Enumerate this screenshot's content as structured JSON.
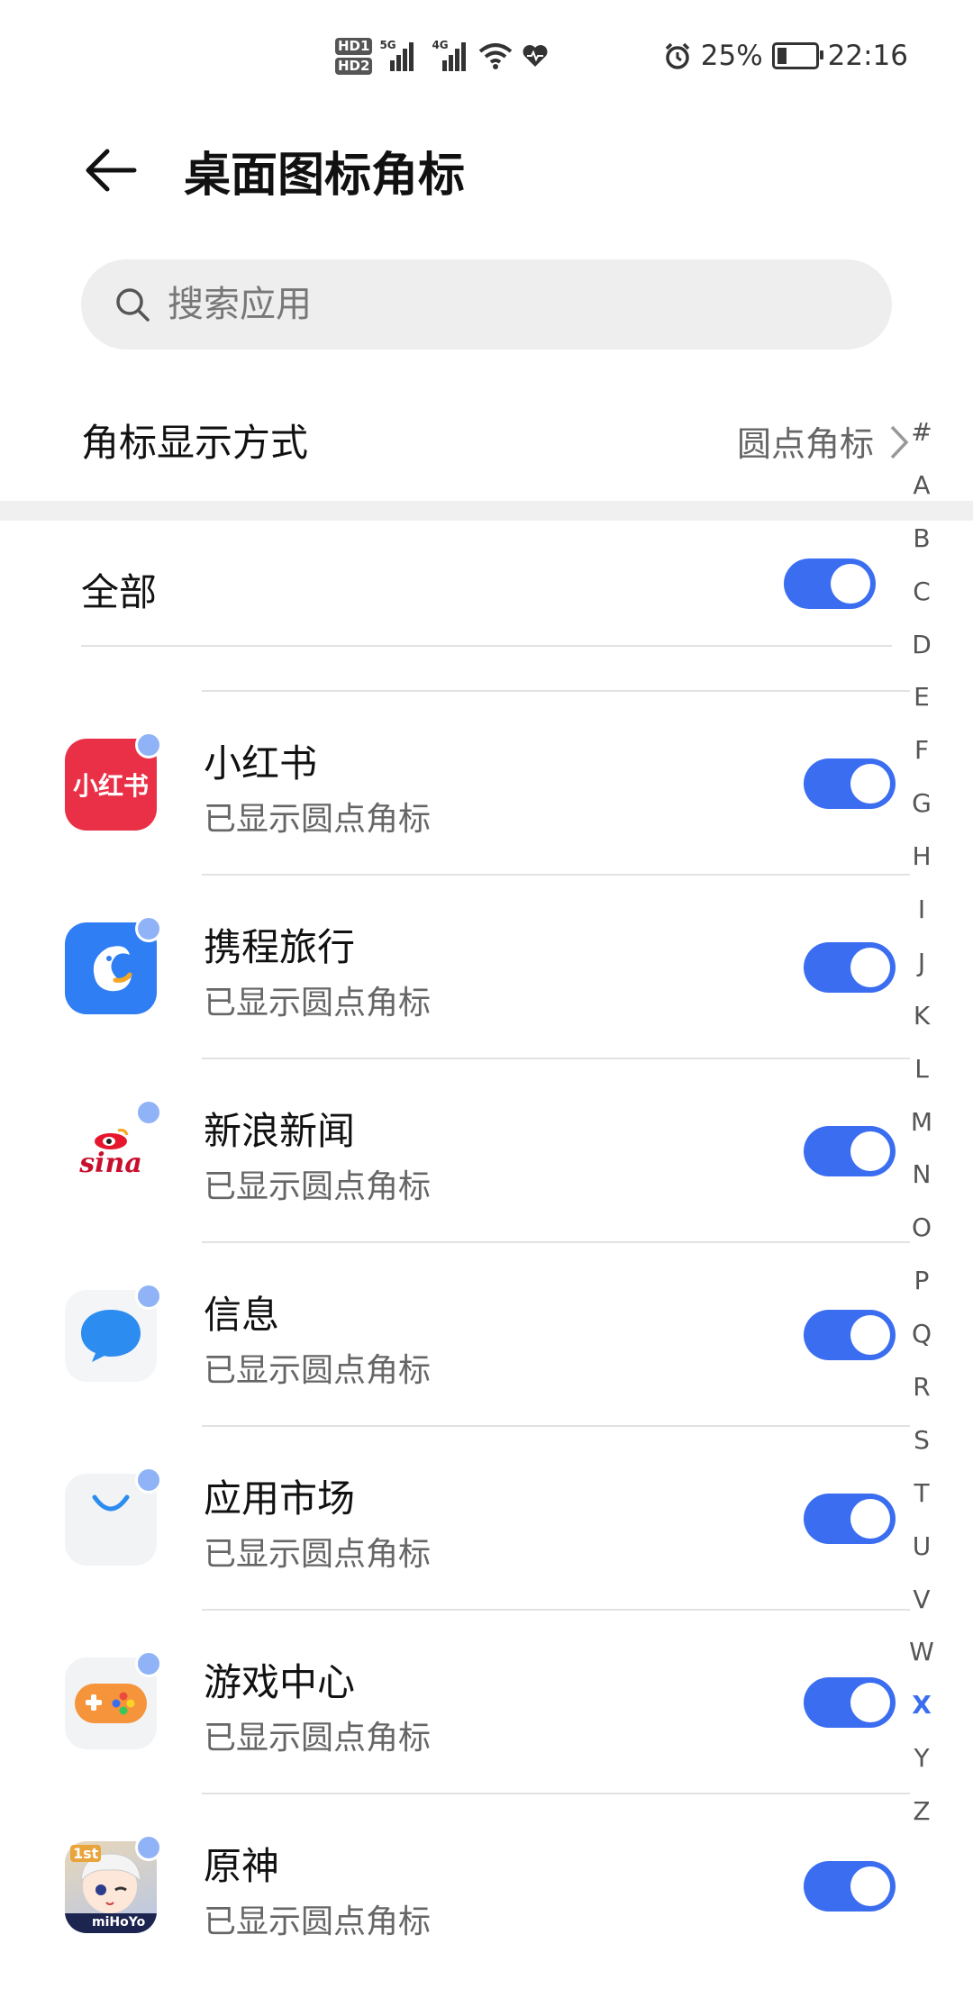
{
  "status_bar": {
    "hd1": "HD1",
    "hd2": "HD2",
    "net1": "5G",
    "net2": "4G",
    "battery": "25%",
    "time": "22:16"
  },
  "header": {
    "title": "桌面图标角标"
  },
  "search": {
    "placeholder": "搜索应用"
  },
  "badge_mode": {
    "label": "角标显示方式",
    "value": "圆点角标"
  },
  "all_toggle": {
    "label": "全部",
    "on": true
  },
  "apps": [
    {
      "name": "小红书",
      "status": "已显示圆点角标",
      "icon": "xiaohongshu-icon",
      "on": true
    },
    {
      "name": "携程旅行",
      "status": "已显示圆点角标",
      "icon": "ctrip-icon",
      "on": true
    },
    {
      "name": "新浪新闻",
      "status": "已显示圆点角标",
      "icon": "sina-icon",
      "on": true
    },
    {
      "name": "信息",
      "status": "已显示圆点角标",
      "icon": "messages-icon",
      "on": true
    },
    {
      "name": "应用市场",
      "status": "已显示圆点角标",
      "icon": "appgallery-icon",
      "on": true
    },
    {
      "name": "游戏中心",
      "status": "已显示圆点角标",
      "icon": "game-center-icon",
      "on": true
    },
    {
      "name": "原神",
      "status": "已显示圆点角标",
      "icon": "genshin-icon",
      "on": true
    }
  ],
  "icon_text": {
    "xiaohongshu": "小红书",
    "sina": "sina",
    "genshin_badge": "1st",
    "genshin_brand": "miHoYo"
  },
  "alpha_index": [
    "#",
    "A",
    "B",
    "C",
    "D",
    "E",
    "F",
    "G",
    "H",
    "I",
    "J",
    "K",
    "L",
    "M",
    "N",
    "O",
    "P",
    "Q",
    "R",
    "S",
    "T",
    "U",
    "V",
    "W",
    "X",
    "Y",
    "Z"
  ],
  "alpha_active": "X",
  "colors": {
    "accent": "#3a6df0",
    "badge_dot": "#8fb3f6"
  }
}
